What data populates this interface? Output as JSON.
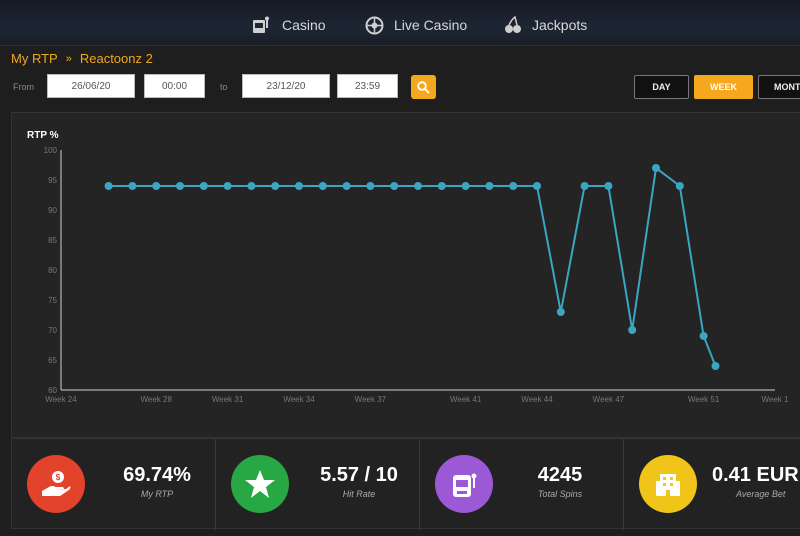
{
  "nav": {
    "items": [
      {
        "label": "Casino",
        "icon": "casino-slot-icon"
      },
      {
        "label": "Live Casino",
        "icon": "roulette-icon"
      },
      {
        "label": "Jackpots",
        "icon": "cherries-icon"
      }
    ]
  },
  "breadcrumb": {
    "root": "My RTP",
    "separator": "»",
    "current": "Reactoonz 2"
  },
  "filters": {
    "from_label": "From",
    "from_date": "26/06/20",
    "from_time": "00:00",
    "to_label": "to",
    "to_date": "23/12/20",
    "to_time": "23:59",
    "periods": {
      "day": "DAY",
      "week": "WEEK",
      "month": "MONT"
    },
    "active_period": "week"
  },
  "chart_data": {
    "type": "line",
    "ylabel": "RTP %",
    "ylim": [
      60,
      100
    ],
    "yticks": [
      100,
      95,
      90,
      85,
      80,
      75,
      70,
      65,
      60
    ],
    "xlim": [
      24,
      54
    ],
    "xticks": [
      24,
      28,
      31,
      34,
      37,
      41,
      44,
      47,
      51,
      54
    ],
    "xtick_labels": [
      "Week 24",
      "Week 28",
      "Week 31",
      "Week 34",
      "Week 37",
      "Week 41",
      "Week 44",
      "Week 47",
      "Week 51",
      "Week 1"
    ],
    "x": [
      26,
      27,
      28,
      29,
      30,
      31,
      32,
      33,
      34,
      35,
      36,
      37,
      38,
      39,
      40,
      41,
      42,
      43,
      44,
      45,
      46,
      47,
      48,
      49,
      50,
      51,
      51.5
    ],
    "values": [
      94,
      94,
      94,
      94,
      94,
      94,
      94,
      94,
      94,
      94,
      94,
      94,
      94,
      94,
      94,
      94,
      94,
      94,
      94,
      73,
      94,
      94,
      70,
      97,
      94,
      69,
      64
    ],
    "line_color": "#3aa6c2",
    "grid": false
  },
  "stats": [
    {
      "value": "69.74%",
      "label": "My RTP",
      "icon": "hand-coin-icon",
      "color": "#e2432a"
    },
    {
      "value": "5.57 / 10",
      "label": "Hit Rate",
      "icon": "star-icon",
      "color": "#27a844"
    },
    {
      "value": "4245",
      "label": "Total Spins",
      "icon": "slot-machine-icon",
      "color": "#9b59d6"
    },
    {
      "value": "0.41 EUR",
      "label": "Average Bet",
      "icon": "building-icon",
      "color": "#f0c419"
    }
  ]
}
